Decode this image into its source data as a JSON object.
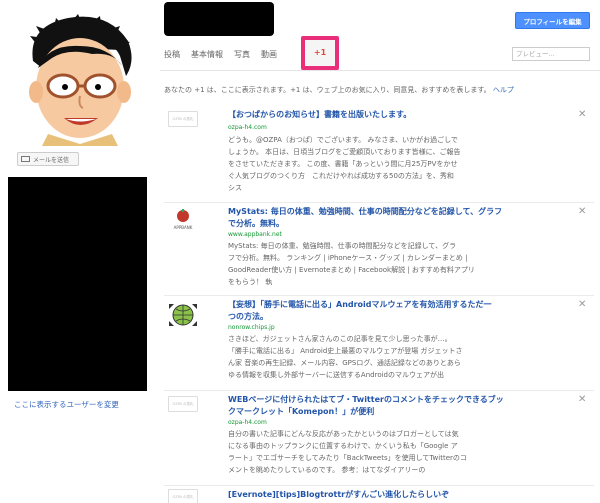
{
  "left": {
    "mail_button": "メールを送信",
    "change_users_link": "ここに表示するユーザーを変更"
  },
  "header": {
    "edit_profile_button": "プロフィールを編集"
  },
  "tabs": {
    "posts": "投稿",
    "basic_info": "基本情報",
    "photos": "写真",
    "videos": "動画",
    "plus_one": "+1",
    "preview_placeholder": "プレビュー..."
  },
  "intro": {
    "text": "あなたの +1 は、ここに表示されます。+1 は、ウェブ上のお気に入り、同意見、おすすめを表します。",
    "help": "ヘルプ"
  },
  "posts": [
    {
      "thumb_label": "OZPA の表札",
      "title": "【おつぱからのお知らせ】書籍を出版いたします。",
      "domain": "ozpa-h4.com",
      "snippet_lines": [
        "どうも。@OZPA（おつぱ）でございます。 みなさま、いかがお過ごしで",
        "しょうか。 本日は、日頃当ブログをご愛顧頂いております皆様に、ご報告",
        "をさせていただきます。 この度、書籍「あっという間に月25万PVをかせ",
        "ぐ人気ブログのつくり方　これだけやれば成功する50の方法」を、秀和",
        "シス"
      ]
    },
    {
      "thumb_label": "APPBANK",
      "title": "MyStats: 毎日の体重、勉強時間、仕事の時間配分などを記録して、グラフ",
      "title2": "で分析。無料。",
      "domain": "www.appbank.net",
      "snippet_lines": [
        "MyStats: 毎日の体重、勉強時間、仕事の時間配分などを記録して、グラ",
        "フで分析。無料。 ランキング | iPhoneケース・グッズ | カレンダーまとめ |",
        "GoodReader使い方 | Evernoteまとめ | Facebook解説 | おすすめ有料アプリ",
        "をもらう！ 執"
      ]
    },
    {
      "thumb_label": "",
      "title": "【妄想】「勝手に電話に出る」Androidマルウェアを有効活用するただ一",
      "title2": "つの方法。",
      "domain": "nonrow.chips.jp",
      "snippet_lines": [
        "さきほど、ガジェットさん家さんのこの記事を見て少し思った事が…。",
        "「勝手に電話に出る」 Android史上最悪のマルウェアが登場 ガジェットさ",
        "ん家 音楽の再生記録、メール内容、GPSログ、通話記録などのありとあら",
        "ゆる情報を収集し外部サーバーに送信するAndroidのマルウェアが出"
      ]
    },
    {
      "thumb_label": "OZPA の表札",
      "title": "WEBページに付けられたはてブ・Twitterのコメントをチェックできるブッ",
      "title2": "クマークレット「Komepon！」が便利",
      "domain": "ozpa-h4.com",
      "snippet_lines": [
        "自分の書いた記事にどんな反応があったかというのはブロガーとしては気",
        "になる事由のトップランクに位置するわけで、かくいう私も「Google ア",
        "ラート」でエゴサーチをしてみたり「BackTweets」を使用してTwitterのコ",
        "メントを眺めたりしているのです。 参考：はてなダイアリーの"
      ]
    },
    {
      "thumb_label": "OZPA の表札",
      "title": "[Evernote][tips]Blogtrottrがすんごい進化したらしいぞ",
      "domain": "",
      "snippet_lines": []
    }
  ],
  "colors": {
    "link_blue": "#2255aa",
    "domain_green": "#119933",
    "active_tab_highlight": "#ea2f7a",
    "button_blue": "#4d90fe"
  }
}
